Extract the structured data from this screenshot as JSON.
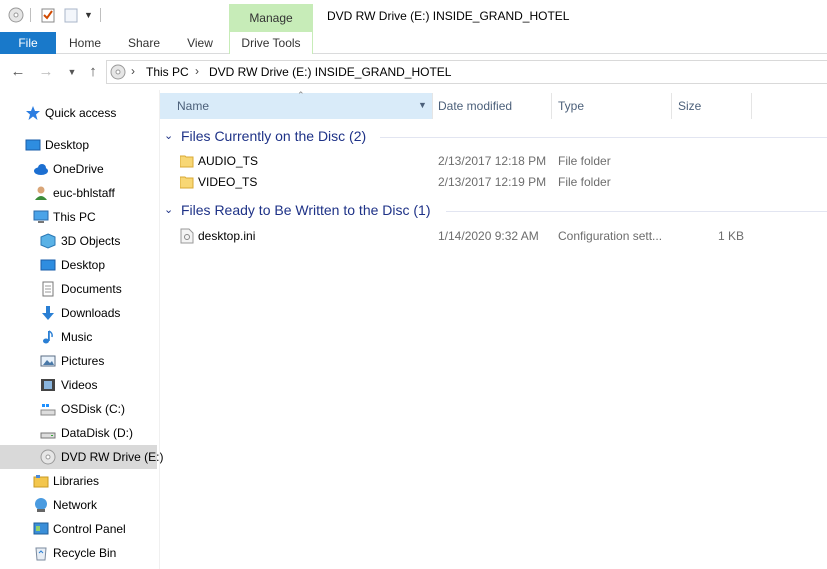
{
  "window": {
    "title": "DVD RW Drive (E:) INSIDE_GRAND_HOTEL",
    "context_tab_group": "Manage"
  },
  "ribbon": {
    "tabs": [
      "File",
      "Home",
      "Share",
      "View",
      "Drive Tools"
    ]
  },
  "address": {
    "crumbs": [
      "This PC",
      "DVD RW Drive (E:) INSIDE_GRAND_HOTEL"
    ]
  },
  "nav": {
    "items": [
      {
        "label": "Quick access",
        "icon": "star-icon"
      },
      {
        "label": "Desktop",
        "icon": "desktop-icon"
      },
      {
        "label": "OneDrive",
        "icon": "cloud-icon"
      },
      {
        "label": "euc-bhlstaff",
        "icon": "user-icon"
      },
      {
        "label": "This PC",
        "icon": "computer-icon"
      },
      {
        "label": "3D Objects",
        "icon": "cube-icon"
      },
      {
        "label": "Desktop",
        "icon": "desktop-icon"
      },
      {
        "label": "Documents",
        "icon": "document-icon"
      },
      {
        "label": "Downloads",
        "icon": "download-icon"
      },
      {
        "label": "Music",
        "icon": "music-icon"
      },
      {
        "label": "Pictures",
        "icon": "picture-icon"
      },
      {
        "label": "Videos",
        "icon": "video-icon"
      },
      {
        "label": "OSDisk (C:)",
        "icon": "windows-drive-icon"
      },
      {
        "label": "DataDisk (D:)",
        "icon": "drive-icon"
      },
      {
        "label": "DVD RW Drive (E:)",
        "icon": "disc-icon",
        "selected": true
      },
      {
        "label": "Libraries",
        "icon": "library-icon"
      },
      {
        "label": "Network",
        "icon": "network-icon"
      },
      {
        "label": "Control Panel",
        "icon": "control-panel-icon"
      },
      {
        "label": "Recycle Bin",
        "icon": "recycle-bin-icon"
      }
    ]
  },
  "columns": {
    "name": "Name",
    "date": "Date modified",
    "type": "Type",
    "size": "Size"
  },
  "groups": [
    {
      "label": "Files Currently on the Disc (2)",
      "rows": [
        {
          "name": "AUDIO_TS",
          "date": "2/13/2017 12:18 PM",
          "type": "File folder",
          "size": "",
          "icon": "folder-icon"
        },
        {
          "name": "VIDEO_TS",
          "date": "2/13/2017 12:19 PM",
          "type": "File folder",
          "size": "",
          "icon": "folder-icon"
        }
      ]
    },
    {
      "label": "Files Ready to Be Written to the Disc (1)",
      "rows": [
        {
          "name": "desktop.ini",
          "date": "1/14/2020 9:32 AM",
          "type": "Configuration sett...",
          "size": "1 KB",
          "icon": "settings-file-icon"
        }
      ]
    }
  ],
  "colors": {
    "accent": "#1979ca",
    "context_tab": "#c7ecb8",
    "group_text": "#1e3287",
    "selected_nav": "#d9d9d9"
  }
}
